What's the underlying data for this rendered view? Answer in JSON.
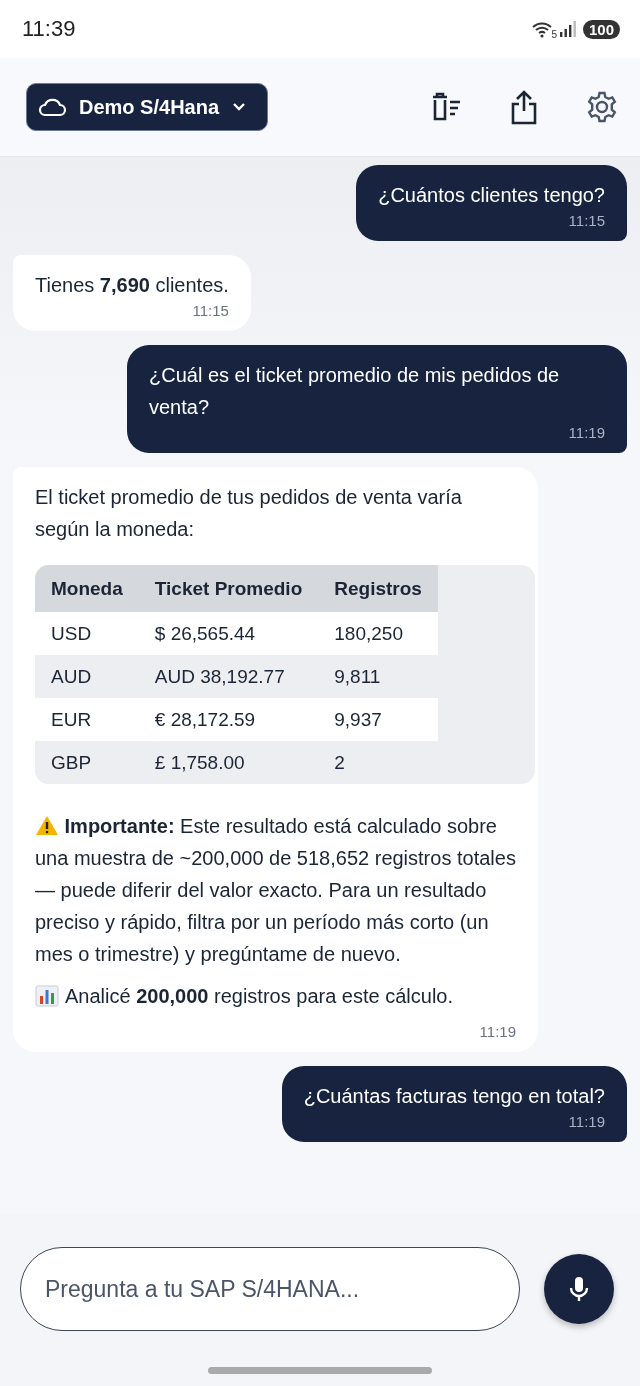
{
  "status_bar": {
    "time": "11:39",
    "wifi_label": "5",
    "battery": "100"
  },
  "header": {
    "workspace": "Demo S/4Hana"
  },
  "messages": [
    {
      "kind": "user",
      "text": "¿Cuántos clientes tengo?",
      "time": "11:15"
    },
    {
      "kind": "assistant",
      "text": "Tienes **7,690** clientes.",
      "time": "11:15"
    },
    {
      "kind": "user",
      "text": "¿Cuál es el ticket promedio de mis pedidos de venta?",
      "time": "11:19"
    },
    {
      "kind": "assistant",
      "text": "El ticket promedio de tus pedidos de venta varía según la moneda:",
      "time": "11:19",
      "table": {
        "columns": [
          "Moneda",
          "Ticket Promedio",
          "Registros"
        ],
        "rows": [
          [
            "USD",
            "$ 26,565.44",
            "180,250"
          ],
          [
            "AUD",
            "AUD 38,192.77",
            "9,811"
          ],
          [
            "EUR",
            "€ 28,172.59",
            "9,937"
          ],
          [
            "GBP",
            "£ 1,758.00",
            "2"
          ]
        ]
      },
      "warning": "**Importante:** Este resultado está calculado sobre una muestra de ~200,000 de 518,652 registros totales — puede diferir del valor exacto. Para un resultado preciso y rápido, filtra por un período más corto (un mes o trimestre) y pregúntame de nuevo.",
      "summary": "Analicé **200,000** registros para este cálculo."
    },
    {
      "kind": "user",
      "text": "¿Cuántas facturas tengo en total?",
      "time": "11:19"
    }
  ],
  "composer": {
    "placeholder": "Pregunta a tu SAP S/4HANA..."
  }
}
